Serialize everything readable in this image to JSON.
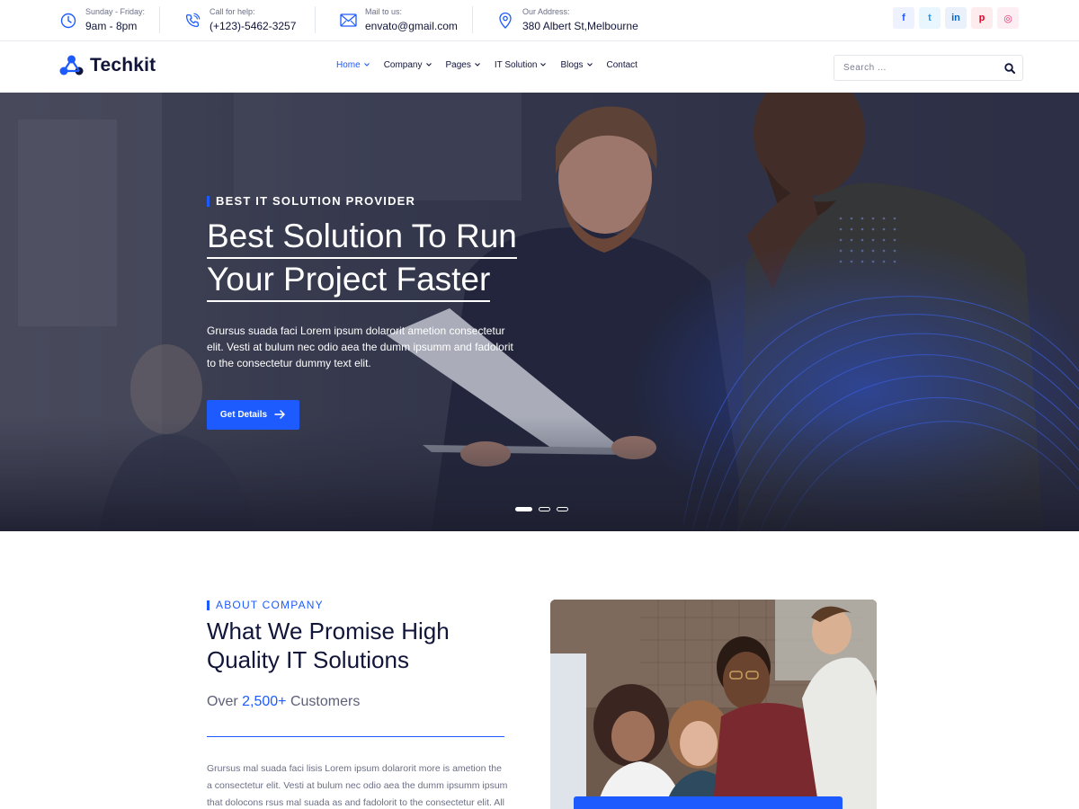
{
  "topbar": {
    "hours": {
      "label": "Sunday - Friday:",
      "value": "9am - 8pm",
      "icon": "clock-icon"
    },
    "phone": {
      "label": "Call for help:",
      "value": "(+123)-5462-3257",
      "icon": "phone-icon"
    },
    "mail": {
      "label": "Mail to us:",
      "value": "envato@gmail.com",
      "icon": "mail-icon"
    },
    "address": {
      "label": "Our Address:",
      "value": "380 Albert St,Melbourne",
      "icon": "location-pin-icon"
    },
    "socials": [
      {
        "name": "facebook-icon",
        "glyph": "f",
        "color": "#1d5bff",
        "bg": "#eef2ff"
      },
      {
        "name": "twitter-icon",
        "glyph": "t",
        "color": "#1d9bf0",
        "bg": "#eaf6fe"
      },
      {
        "name": "linkedin-icon",
        "glyph": "in",
        "color": "#0a66c2",
        "bg": "#eaf1fb"
      },
      {
        "name": "pinterest-icon",
        "glyph": "p",
        "color": "#e60023",
        "bg": "#fdecee"
      },
      {
        "name": "instagram-icon",
        "glyph": "◎",
        "color": "#e1306c",
        "bg": "#fdeef3"
      }
    ]
  },
  "nav": {
    "logo": "Techkit",
    "menu": [
      {
        "label": "Home",
        "dropdown": true,
        "active": true
      },
      {
        "label": "Company",
        "dropdown": true,
        "active": false
      },
      {
        "label": "Pages",
        "dropdown": true,
        "active": false
      },
      {
        "label": "IT Solution",
        "dropdown": true,
        "active": false
      },
      {
        "label": "Blogs",
        "dropdown": true,
        "active": false
      },
      {
        "label": "Contact",
        "dropdown": false,
        "active": false
      }
    ],
    "search_placeholder": "Search ..."
  },
  "hero": {
    "tagline": "BEST IT SOLUTION PROVIDER",
    "title_line1": "Best Solution To Run",
    "title_line2": "Your Project Faster",
    "description": "Grursus suada faci Lorem ipsum dolarorit ametion consectetur elit. Vesti at bulum nec odio aea the dumm ipsumm and fadolorit to the consectetur dummy text elit.",
    "button_label": "Get Details",
    "slides": 3,
    "active_slide": 1
  },
  "about": {
    "tagline": "ABOUT COMPANY",
    "title": "What We Promise High Quality IT Solutions",
    "customers_prefix": "Over",
    "customers_count": "2,500+",
    "customers_suffix": "Customers",
    "description": "Grursus mal suada faci lisis Lorem ipsum dolarorit more is ametion the a consectetur elit. Vesti at bulum nec odio aea the dumm ipsumm ipsum that dolocons rsus mal suada as and fadolorit to the consectetur elit. All"
  },
  "colors": {
    "accent": "#1d5bff",
    "heading": "#101539",
    "body": "#6b6f86"
  }
}
